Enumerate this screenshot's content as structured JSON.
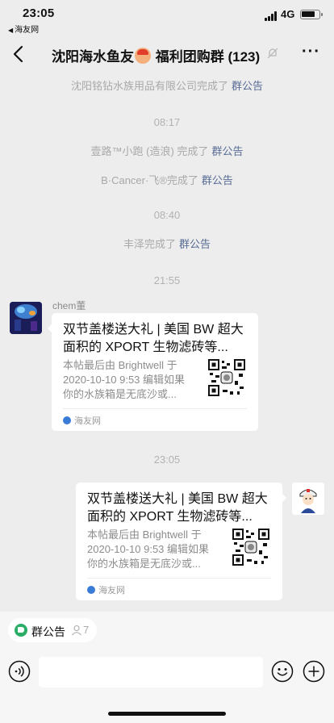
{
  "status_bar": {
    "time": "23:05",
    "back_app": "海友网",
    "network": "4G",
    "battery_level": 0.8
  },
  "nav": {
    "title_prefix": "沈阳海水鱼友",
    "title_suffix": "福利团购群 (123)",
    "icons": [
      "back-arrow-icon",
      "mute-bell-icon",
      "more-dots-icon"
    ]
  },
  "messages": {
    "sys1": {
      "actor": "沈阳铭钻水族用品有限公司完成了",
      "link": "群公告"
    },
    "time1": "08:17",
    "sys2": {
      "actor": "壹路™小跑 (造浪) 完成了",
      "link": "群公告"
    },
    "sys3": {
      "actor": "B·Cancer·飞®完成了",
      "link": "群公告"
    },
    "time2": "08:40",
    "sys4": {
      "actor": "丰泽完成了",
      "link": "群公告"
    },
    "time3": "21:55",
    "sender_name": "chem董",
    "card1": {
      "title": "双节盖楼送大礼 | 美国 BW 超大面积的 XPORT 生物滤砖等...",
      "desc": "本帖最后由 Brightwell 于 2020-10-10 9:53 编辑如果你的水族箱是无底沙或...",
      "source": "海友网"
    },
    "time4": "23:05",
    "card2": {
      "title": "双节盖楼送大礼 | 美国 BW 超大面积的 XPORT 生物滤砖等...",
      "desc": "本帖最后由 Brightwell 于 2020-10-10 9:53 编辑如果你的水族箱是无底沙或...",
      "source": "海友网"
    }
  },
  "bottom": {
    "notice_label": "群公告",
    "notice_count": "7",
    "input_value": "",
    "icons": [
      "voice-icon",
      "emoji-icon",
      "plus-icon"
    ]
  },
  "colors": {
    "background": "#ededed",
    "link": "#576b95",
    "notice_green": "#2aae67"
  }
}
